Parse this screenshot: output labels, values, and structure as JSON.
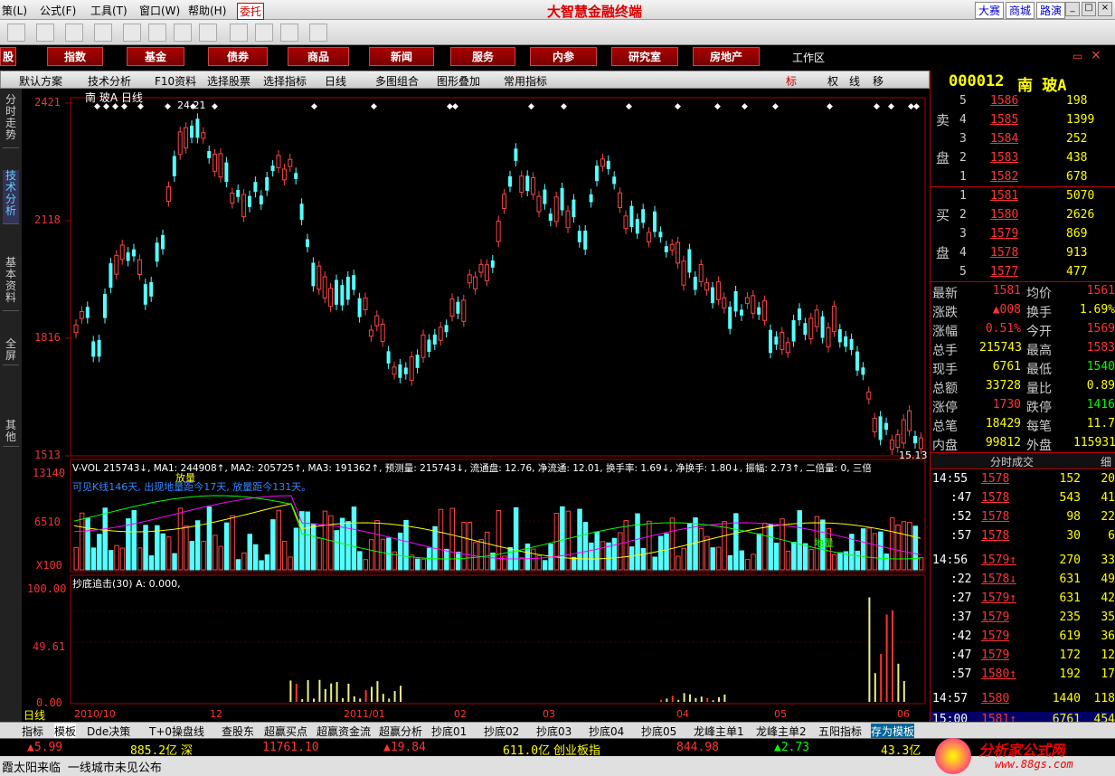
{
  "menubar": {
    "items": [
      "策(L)",
      "公式(F)",
      "工具(T)",
      "窗口(W)",
      "帮助(H)"
    ],
    "entrust": "委托",
    "brand": "大智慧金融终端",
    "right_buttons": [
      "大赛",
      "商城",
      "路演"
    ]
  },
  "navbar": {
    "items": [
      "股",
      "指数",
      "基金",
      "债券",
      "商品",
      "新闻",
      "服务",
      "内参",
      "研究室",
      "房地产"
    ],
    "workspace": "工作区"
  },
  "tabbar": {
    "items": [
      "默认方案",
      "技术分析",
      "F10资料",
      "选择股票",
      "选择指标",
      "日线",
      "多图组合",
      "图形叠加",
      "常用指标"
    ],
    "right": [
      "标",
      "权",
      "线",
      "移"
    ]
  },
  "sidetabs": [
    "分时走势",
    "技术分析",
    "基本资料",
    "全屏",
    "其他"
  ],
  "chart": {
    "header": "南 玻A 日线",
    "price_labels": [
      "2421",
      "2118",
      "1816",
      "1513"
    ],
    "high_label": "24.21",
    "low_label": "15.13",
    "vol_labels": [
      "13140",
      "6510",
      "X100"
    ],
    "ind_labels": [
      "100.00",
      "49.61",
      "0.00"
    ],
    "vol_line": "V-VOL 215743↓, MA1: 244908↑, MA2: 205725↑, MA3: 191362↑, 预测量: 215743↓, 流通盘: 12.76, 净流通: 12.01, 换手率: 1.69↓, 净换手: 1.80↓, 振幅: 2.73↑, 二倍量: 0, 三倍",
    "vol_note": "可见K线146天, 出现地量距今17天, 放量距今131天。",
    "fangliang": "放量",
    "diliang": "地量",
    "ind_line": "抄底追击(30) A: 0.000,",
    "date_labels": [
      "2010/10",
      "12",
      "2011/01",
      "02",
      "03",
      "04",
      "05",
      "06"
    ],
    "period": "日线"
  },
  "quote": {
    "code": "000012",
    "name": "南 玻A",
    "sell": [
      {
        "lvl": "5",
        "p": "1586",
        "v": "198"
      },
      {
        "lvl": "4",
        "p": "1585",
        "v": "1399"
      },
      {
        "lvl": "3",
        "p": "1584",
        "v": "252"
      },
      {
        "lvl": "2",
        "p": "1583",
        "v": "438"
      },
      {
        "lvl": "1",
        "p": "1582",
        "v": "678"
      }
    ],
    "buy": [
      {
        "lvl": "1",
        "p": "1581",
        "v": "5070"
      },
      {
        "lvl": "2",
        "p": "1580",
        "v": "2626"
      },
      {
        "lvl": "3",
        "p": "1579",
        "v": "869"
      },
      {
        "lvl": "4",
        "p": "1578",
        "v": "913"
      },
      {
        "lvl": "5",
        "p": "1577",
        "v": "477"
      }
    ],
    "sell_label": [
      "卖",
      "盘"
    ],
    "buy_label": [
      "买",
      "盘"
    ],
    "stats": [
      [
        "最新",
        "1581",
        "均价",
        "1561"
      ],
      [
        "涨跌",
        "▲008",
        "换手",
        "1.69%"
      ],
      [
        "涨幅",
        "0.51%",
        "今开",
        "1569"
      ],
      [
        "总手",
        "215743",
        "最高",
        "1583"
      ],
      [
        "现手",
        "6761",
        "最低",
        "1540"
      ],
      [
        "总额",
        "33728",
        "量比",
        "0.89"
      ],
      [
        "涨停",
        "1730",
        "跌停",
        "1416"
      ],
      [
        "总笔",
        "18429",
        "每笔",
        "11.7"
      ],
      [
        "内盘",
        "99812",
        "外盘",
        "115931"
      ]
    ],
    "trade_header": "分时成交",
    "detail": "细",
    "trades": [
      [
        "14:55",
        "1578",
        "152",
        "20"
      ],
      [
        ":47",
        "1578",
        "543",
        "41"
      ],
      [
        ":52",
        "1578",
        "98",
        "22"
      ],
      [
        ":57",
        "1578",
        "30",
        "6"
      ],
      [
        "14:56",
        "1579↑",
        "270",
        "33"
      ],
      [
        ":22",
        "1578↓",
        "631",
        "49"
      ],
      [
        ":27",
        "1579↑",
        "631",
        "42"
      ],
      [
        ":37",
        "1579",
        "235",
        "35"
      ],
      [
        ":42",
        "1579",
        "619",
        "36"
      ],
      [
        ":47",
        "1579",
        "172",
        "12"
      ],
      [
        ":57",
        "1580↑",
        "192",
        "17"
      ],
      [
        "14:57",
        "1580",
        "1440",
        "118"
      ],
      [
        "15:00",
        "1581↑",
        "6761",
        "454"
      ]
    ]
  },
  "bottomtabs": [
    "指标",
    "模板",
    "Dde决策",
    "T+0操盘线",
    "查股东",
    "超赢买点",
    "超赢资金流",
    "超赢分析",
    "抄底01",
    "抄底02",
    "抄底03",
    "抄底04",
    "抄底05",
    "龙峰主单1",
    "龙峰主单2",
    "五阳指标",
    "存为模板"
  ],
  "status": {
    "a": "▲5.99",
    "b": "885.2亿",
    "c": "深",
    "d": "11761.10",
    "e": "▲19.84",
    "f": "611.0亿",
    "g": "创业板指",
    "h": "844.98",
    "i": "▲2.73",
    "j": "43.3亿"
  },
  "ticker": "霞太阳来临 一线城市未见公布",
  "logo": {
    "name": "分析家公式网",
    "url": "www.88gs.com"
  },
  "chart_data": {
    "type": "candlestick",
    "price_axis": [
      1513,
      2421
    ],
    "volume_axis": [
      0,
      13140
    ],
    "indicator_axis": [
      0,
      100
    ]
  }
}
